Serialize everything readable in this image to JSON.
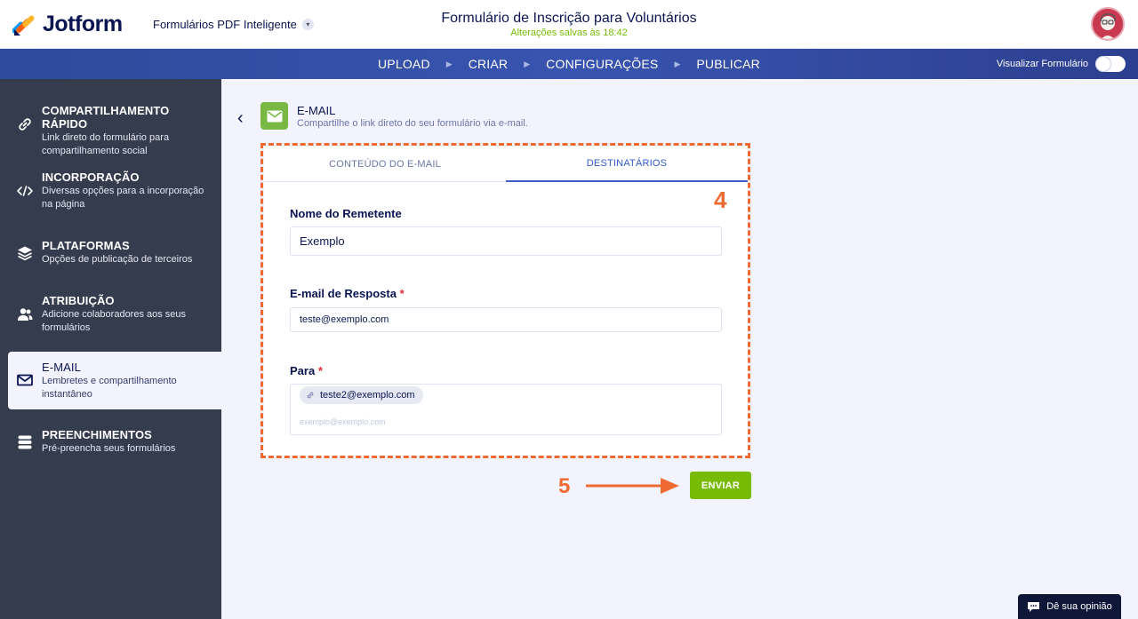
{
  "header": {
    "logo_text": "Jotform",
    "product_name": "Formulários PDF Inteligente",
    "form_title": "Formulário de Inscrição para Voluntários",
    "saved_status": "Alterações salvas às 18:42"
  },
  "nav": {
    "steps": [
      "UPLOAD",
      "CRIAR",
      "CONFIGURAÇÕES",
      "PUBLICAR"
    ],
    "preview_label": "Visualizar Formulário"
  },
  "sidebar": {
    "items": [
      {
        "title": "COMPARTILHAMENTO RÁPIDO",
        "desc": "Link direto do formulário para compartilhamento social",
        "icon": "link-icon"
      },
      {
        "title": "INCORPORAÇÃO",
        "desc": "Diversas opções para a incorporação na página",
        "icon": "code-icon"
      },
      {
        "title": "PLATAFORMAS",
        "desc": "Opções de publicação de terceiros",
        "icon": "layers-icon"
      },
      {
        "title": "ATRIBUIÇÃO",
        "desc": "Adicione colaboradores aos seus formulários",
        "icon": "users-icon"
      },
      {
        "title": "E-MAIL",
        "desc": "Lembretes e compartilhamento instantâneo",
        "icon": "mail-icon"
      },
      {
        "title": "PREENCHIMENTOS",
        "desc": "Pré-preencha seus formulários",
        "icon": "database-icon"
      }
    ],
    "active_index": 4
  },
  "main": {
    "section_title": "E-MAIL",
    "section_subtitle": "Compartilhe o link direto do seu formulário via e-mail.",
    "tabs": [
      "CONTEÚDO DO E-MAIL",
      "DESTINATÁRIOS"
    ],
    "active_tab": 1,
    "sender_label": "Nome do Remetente",
    "sender_value": "Exemplo",
    "reply_label": "E-mail de Resposta",
    "reply_value": "teste@exemplo.com",
    "to_label": "Para",
    "to_chip": "teste2@exemplo.com",
    "to_placeholder": "exemplo@exemplo.com",
    "required_mark": "*",
    "send_label": "ENVIAR",
    "annotation_4": "4",
    "annotation_5": "5"
  },
  "feedback_label": "Dê sua opinião",
  "colors": {
    "accent_orange": "#ef6a31",
    "send_green": "#78bb07",
    "sidebar_bg": "#343c4e",
    "nav_blue": "#3854b0"
  }
}
